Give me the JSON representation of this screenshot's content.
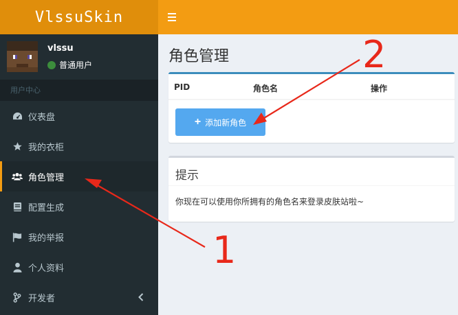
{
  "header": {
    "logo_text": "VlssuSkin",
    "toggle_icon": "hamburger-icon"
  },
  "user": {
    "name": "vlssu",
    "role": "普通用户",
    "status_color": "#3c8d3c"
  },
  "sidebar": {
    "section_label": "用户中心",
    "items": [
      {
        "label": "仪表盘",
        "icon": "dashboard-icon"
      },
      {
        "label": "我的衣柜",
        "icon": "star-icon"
      },
      {
        "label": "角色管理",
        "icon": "users-icon",
        "active": true
      },
      {
        "label": "配置生成",
        "icon": "book-icon"
      },
      {
        "label": "我的举报",
        "icon": "flag-icon"
      },
      {
        "label": "个人资料",
        "icon": "user-icon"
      },
      {
        "label": "开发者",
        "icon": "code-branch-icon"
      }
    ]
  },
  "main": {
    "title": "角色管理",
    "table": {
      "columns": [
        "PID",
        "角色名",
        "操作"
      ]
    },
    "add_button_label": "添加新角色",
    "notice": {
      "title": "提示",
      "body": "你现在可以使用你所拥有的角色名来登录皮肤站啦~"
    }
  },
  "annotations": {
    "label_1": "1",
    "label_2": "2",
    "color": "#e8281a"
  },
  "colors": {
    "accent": "#f39c12",
    "logo_bg": "#e08e0b",
    "sidebar_bg": "#222d32",
    "primary_box": "#3c8dbc",
    "button": "#54a8ef"
  }
}
